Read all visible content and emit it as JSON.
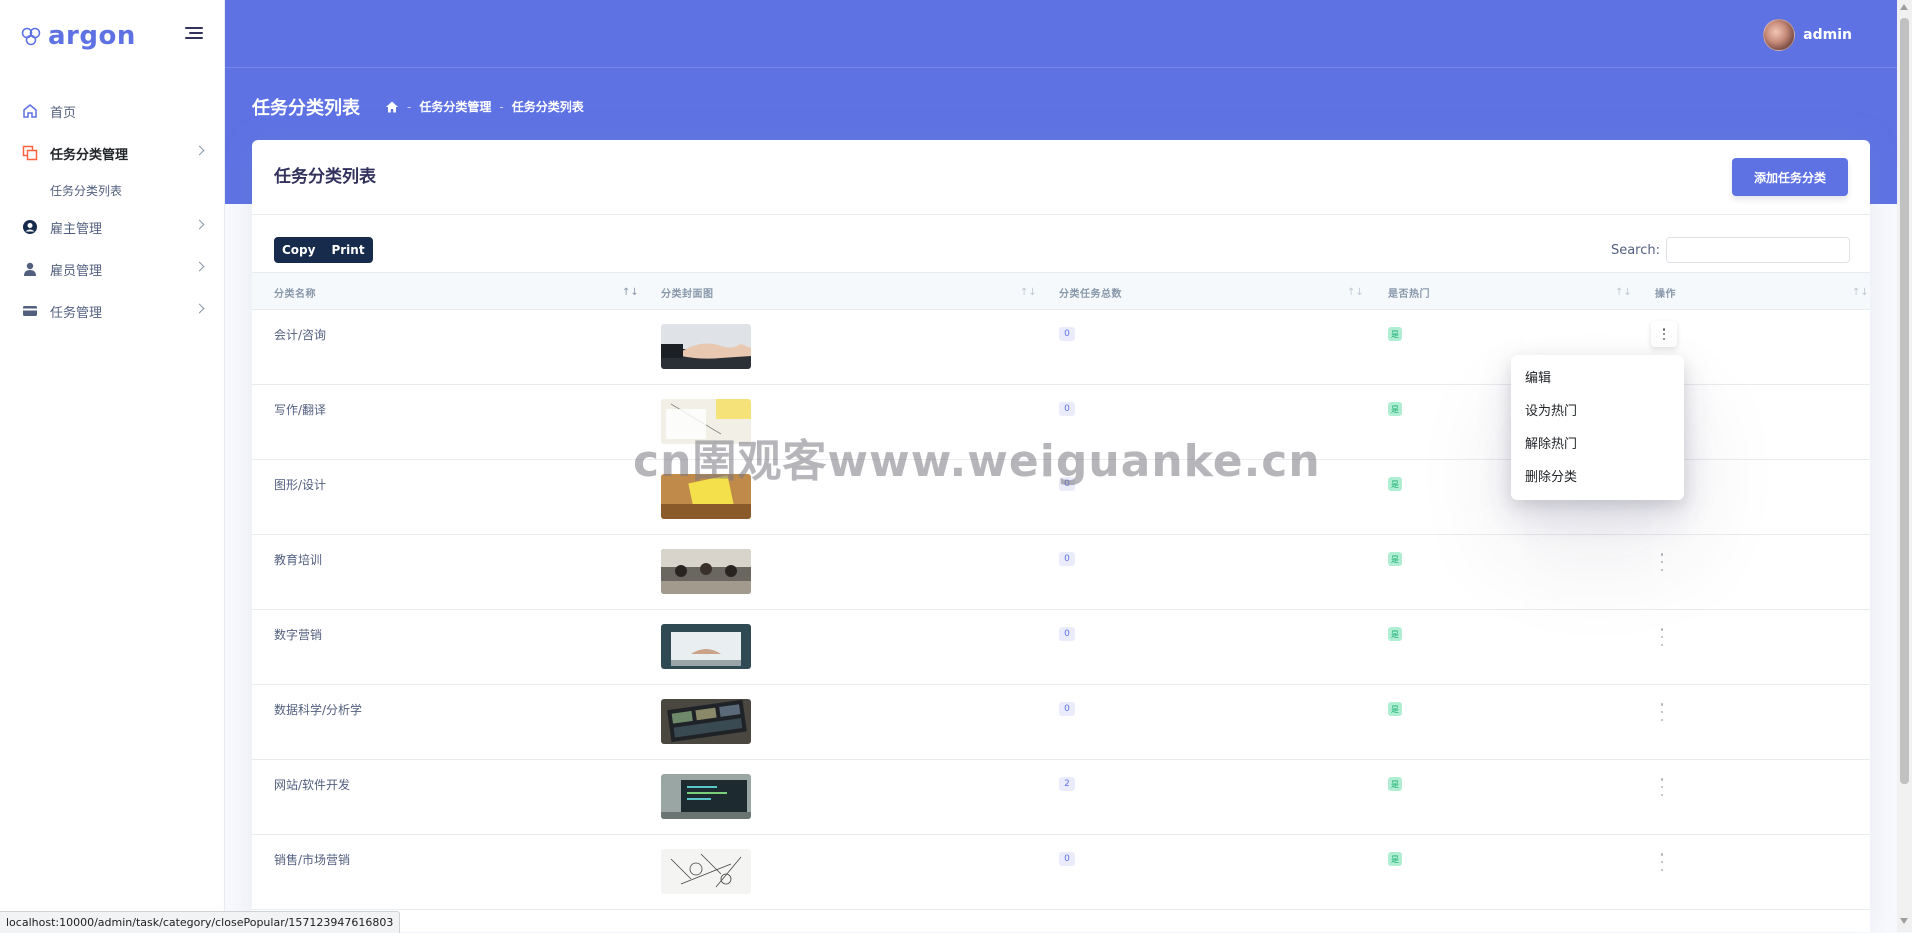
{
  "brand": {
    "name": "argon"
  },
  "sidebar": {
    "items": [
      {
        "label": "首页"
      },
      {
        "label": "任务分类管理",
        "sub": [
          {
            "label": "任务分类列表"
          }
        ]
      },
      {
        "label": "雇主管理"
      },
      {
        "label": "雇员管理"
      },
      {
        "label": "任务管理"
      }
    ]
  },
  "header": {
    "user": "admin",
    "title": "任务分类列表",
    "breadcrumb": [
      "任务分类管理",
      "任务分类列表"
    ]
  },
  "card": {
    "title": "任务分类列表",
    "add_button": "添加任务分类",
    "buttons": {
      "copy": "Copy",
      "print": "Print"
    },
    "search_label": "Search:"
  },
  "table": {
    "columns": [
      "分类名称",
      "分类封面图",
      "分类任务总数",
      "是否热门",
      "操作"
    ],
    "rows": [
      {
        "name": "会计/咨询",
        "count": "0",
        "hot": "是",
        "image": "handshake"
      },
      {
        "name": "写作/翻译",
        "count": "0",
        "hot": "是",
        "image": "writing"
      },
      {
        "name": "图形/设计",
        "count": "0",
        "hot": "是",
        "image": "design"
      },
      {
        "name": "教育培训",
        "count": "0",
        "hot": "是",
        "image": "classroom"
      },
      {
        "name": "数字营销",
        "count": "0",
        "hot": "是",
        "image": "laptop-typing"
      },
      {
        "name": "数据科学/分析学",
        "count": "0",
        "hot": "是",
        "image": "dashboard"
      },
      {
        "name": "网站/软件开发",
        "count": "2",
        "hot": "是",
        "image": "code-laptop"
      },
      {
        "name": "销售/市场营销",
        "count": "0",
        "hot": "是",
        "image": "sketch"
      }
    ]
  },
  "dropdown": {
    "items": [
      "编辑",
      "设为热门",
      "解除热门",
      "删除分类"
    ]
  },
  "status_url": "localhost:10000/admin/task/category/closePopular/157123947616803",
  "watermark": "cn圉观客www.weiguanke.cn",
  "colors": {
    "primary": "#5e72e4",
    "dark": "#172b4d",
    "success_bg": "#b0eed3"
  }
}
